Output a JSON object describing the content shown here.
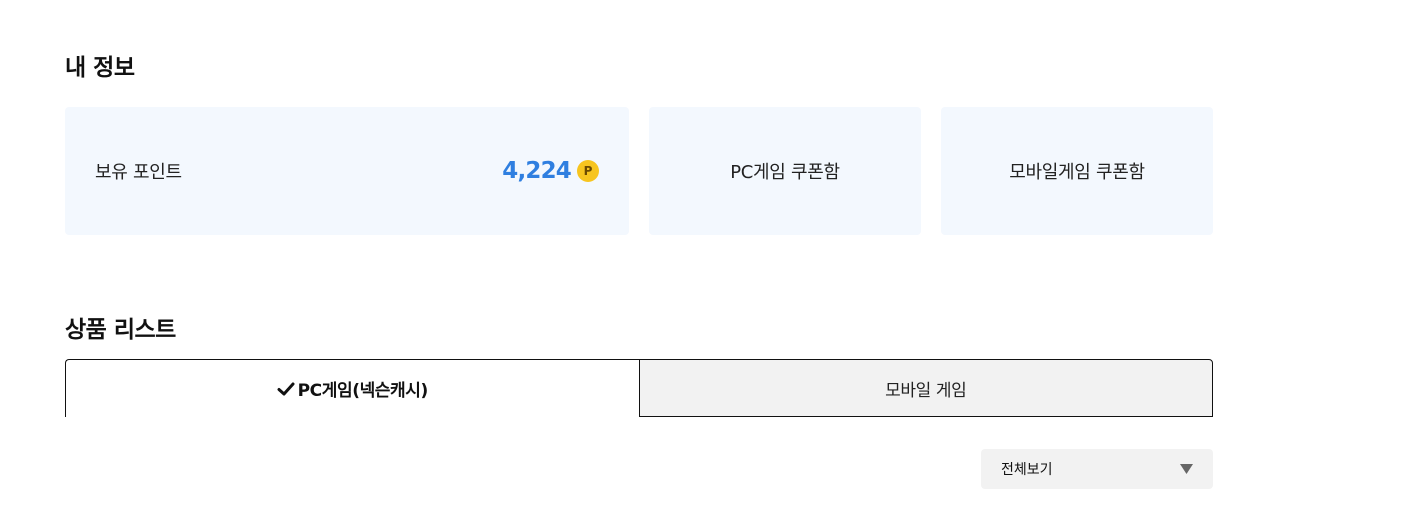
{
  "my_info": {
    "title": "내 정보",
    "points_label": "보유 포인트",
    "points_value": "4,224",
    "points_badge": "P",
    "pc_coupon_label": "PC게임 쿠폰함",
    "mobile_coupon_label": "모바일게임 쿠폰함"
  },
  "product_list": {
    "title": "상품 리스트",
    "tabs": [
      {
        "label": "PC게임(넥슨캐시)",
        "active": true
      },
      {
        "label": "모바일 게임",
        "active": false
      }
    ],
    "filter": {
      "selected": "전체보기",
      "icon": "dropdown-arrow-icon"
    }
  },
  "colors": {
    "card_background": "#f3f8fe",
    "points_value": "#2f7fe0",
    "badge": "#f7c51f",
    "inactive_tab": "#f2f2f2"
  }
}
